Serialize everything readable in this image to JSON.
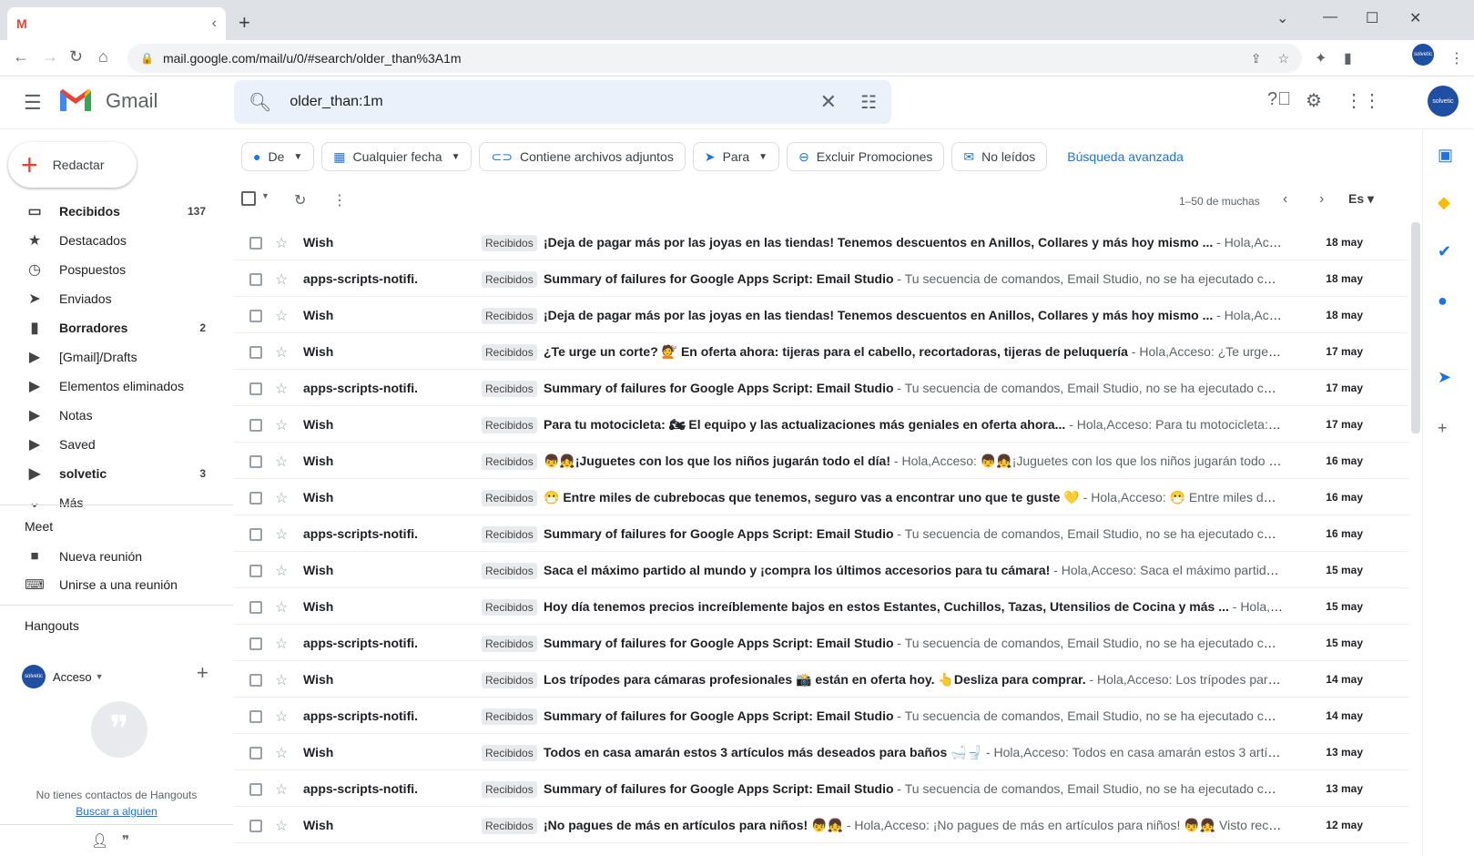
{
  "browser": {
    "tab_favicon": "M",
    "url": "mail.google.com/mail/u/0/#search/older_than%3A1m"
  },
  "header": {
    "app_name": "Gmail",
    "search_query": "older_than:1m"
  },
  "compose_label": "Redactar",
  "nav": [
    {
      "label": "Recibidos",
      "count": "137",
      "icon": "inbox-icon",
      "bold": true
    },
    {
      "label": "Destacados",
      "count": "",
      "icon": "star-icon",
      "bold": false
    },
    {
      "label": "Pospuestos",
      "count": "",
      "icon": "clock-icon",
      "bold": false
    },
    {
      "label": "Enviados",
      "count": "",
      "icon": "send-icon",
      "bold": false
    },
    {
      "label": "Borradores",
      "count": "2",
      "icon": "draft-icon",
      "bold": true
    },
    {
      "label": "[Gmail]/Drafts",
      "count": "",
      "icon": "label-icon",
      "bold": false
    },
    {
      "label": "Elementos eliminados",
      "count": "",
      "icon": "label-icon",
      "bold": false
    },
    {
      "label": "Notas",
      "count": "",
      "icon": "label-icon",
      "bold": false
    },
    {
      "label": "Saved",
      "count": "",
      "icon": "label-icon",
      "bold": false
    },
    {
      "label": "solvetic",
      "count": "3",
      "icon": "label-icon",
      "bold": true
    },
    {
      "label": "Más",
      "count": "",
      "icon": "chevron-down-icon",
      "bold": false
    }
  ],
  "meet": {
    "title": "Meet",
    "new_meeting": "Nueva reunión",
    "join_meeting": "Unirse a una reunión"
  },
  "hangouts": {
    "title": "Hangouts",
    "user": "Acceso",
    "avatar_text": "solvetic",
    "empty_text": "No tienes contactos de Hangouts",
    "find_link": "Buscar a alguien"
  },
  "filters": {
    "from": "De",
    "date": "Cualquier fecha",
    "attachments": "Contiene archivos adjuntos",
    "to": "Para",
    "exclude": "Excluir Promociones",
    "unread": "No leídos",
    "advanced": "Búsqueda avanzada"
  },
  "toolbar": {
    "pagination": "1–50 de muchas",
    "lang": "Es"
  },
  "emails": [
    {
      "sender": "Wish",
      "label": "Recibidos",
      "subject": "¡Deja de pagar más por las joyas en las tiendas! Tenemos descuentos en Anillos, Collares y más hoy mismo ...",
      "snippet": " - Hola,Acceso: ¡D…",
      "date": "18 may"
    },
    {
      "sender": "apps-scripts-notifi.",
      "label": "Recibidos",
      "subject": "Summary of failures for Google Apps Script: Email Studio",
      "snippet": " - Tu secuencia de comandos, Email Studio, no se ha ejecutado correct…",
      "date": "18 may"
    },
    {
      "sender": "Wish",
      "label": "Recibidos",
      "subject": "¡Deja de pagar más por las joyas en las tiendas! Tenemos descuentos en Anillos, Collares y más hoy mismo ...",
      "snippet": " - Hola,Acceso: ¡D…",
      "date": "18 may"
    },
    {
      "sender": "Wish",
      "label": "Recibidos",
      "subject": "¿Te urge un corte? 💇 En oferta ahora: tijeras para el cabello, recortadoras, tijeras de peluquería",
      "snippet": " - Hola,Acceso: ¿Te urge un cort…",
      "date": "17 may"
    },
    {
      "sender": "apps-scripts-notifi.",
      "label": "Recibidos",
      "subject": "Summary of failures for Google Apps Script: Email Studio",
      "snippet": " - Tu secuencia de comandos, Email Studio, no se ha ejecutado correct…",
      "date": "17 may"
    },
    {
      "sender": "Wish",
      "label": "Recibidos",
      "subject": "Para tu motocicleta: 🏍 El equipo y las actualizaciones más geniales en oferta ahora...",
      "snippet": " - Hola,Acceso: Para tu motocicleta: 🏍 El…",
      "date": "17 may"
    },
    {
      "sender": "Wish",
      "label": "Recibidos",
      "subject": "👦👧¡Juguetes con los que los niños jugarán todo el día!",
      "snippet": " - Hola,Acceso: 👦👧¡Juguetes con los que los niños jugarán todo el día…",
      "date": "16 may"
    },
    {
      "sender": "Wish",
      "label": "Recibidos",
      "subject": "😷 Entre miles de cubrebocas que tenemos, seguro vas a encontrar uno que te guste 💛",
      "snippet": " - Hola,Acceso: 😷 Entre miles de cubre…",
      "date": "16 may"
    },
    {
      "sender": "apps-scripts-notifi.",
      "label": "Recibidos",
      "subject": "Summary of failures for Google Apps Script: Email Studio",
      "snippet": " - Tu secuencia de comandos, Email Studio, no se ha ejecutado correct…",
      "date": "16 may"
    },
    {
      "sender": "Wish",
      "label": "Recibidos",
      "subject": "Saca el máximo partido al mundo y ¡compra los últimos accesorios para tu cámara!",
      "snippet": " - Hola,Acceso: Saca el máximo partido al m…",
      "date": "15 may"
    },
    {
      "sender": "Wish",
      "label": "Recibidos",
      "subject": "Hoy día tenemos precios increíblemente bajos en estos Estantes, Cuchillos, Tazas, Utensilios de Cocina y más ...",
      "snippet": " - Hola,Acceso…",
      "date": "15 may"
    },
    {
      "sender": "apps-scripts-notifi.",
      "label": "Recibidos",
      "subject": "Summary of failures for Google Apps Script: Email Studio",
      "snippet": " - Tu secuencia de comandos, Email Studio, no se ha ejecutado correct…",
      "date": "15 may"
    },
    {
      "sender": "Wish",
      "label": "Recibidos",
      "subject": "Los trípodes para cámaras profesionales 📸 están en oferta hoy. 👆Desliza para comprar.",
      "snippet": " - Hola,Acceso: Los trípodes para cáma…",
      "date": "14 may"
    },
    {
      "sender": "apps-scripts-notifi.",
      "label": "Recibidos",
      "subject": "Summary of failures for Google Apps Script: Email Studio",
      "snippet": " - Tu secuencia de comandos, Email Studio, no se ha ejecutado correct…",
      "date": "14 may"
    },
    {
      "sender": "Wish",
      "label": "Recibidos",
      "subject": "Todos en casa amarán estos 3 artículos más deseados para baños 🛁🚽",
      "snippet": " - Hola,Acceso: Todos en casa amarán estos 3 artículos…",
      "date": "13 may"
    },
    {
      "sender": "apps-scripts-notifi.",
      "label": "Recibidos",
      "subject": "Summary of failures for Google Apps Script: Email Studio",
      "snippet": " - Tu secuencia de comandos, Email Studio, no se ha ejecutado correct…",
      "date": "13 may"
    },
    {
      "sender": "Wish",
      "label": "Recibidos",
      "subject": "¡No pagues de más en artículos para niños! 👦👧",
      "snippet": " - Hola,Acceso: ¡No pagues de más en artículos para niños! 👦👧 Visto reciente…",
      "date": "12 may"
    }
  ],
  "colors": {
    "accent": "#1a73e8",
    "search_bg": "#eaf1fb",
    "gmail_red": "#ea4335"
  }
}
